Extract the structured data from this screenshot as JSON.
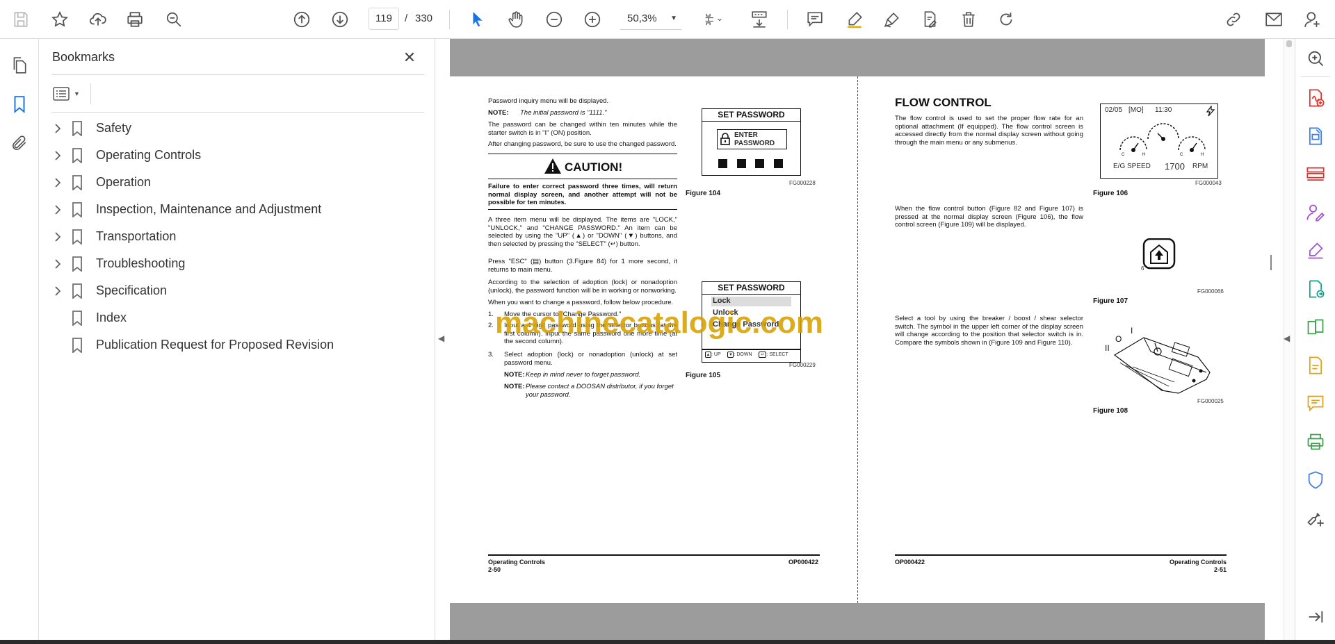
{
  "toolbar": {
    "page_current": "119",
    "page_separator": "/",
    "page_total": "330",
    "zoom": "50,3%"
  },
  "bookmarks": {
    "title": "Bookmarks",
    "items": [
      {
        "label": "Safety",
        "expandable": true
      },
      {
        "label": "Operating Controls",
        "expandable": true
      },
      {
        "label": "Operation",
        "expandable": true
      },
      {
        "label": "Inspection, Maintenance and Adjustment",
        "expandable": true
      },
      {
        "label": "Transportation",
        "expandable": true
      },
      {
        "label": "Troubleshooting",
        "expandable": true
      },
      {
        "label": "Specification",
        "expandable": true
      },
      {
        "label": "Index",
        "expandable": false
      },
      {
        "label": "Publication Request for Proposed Revision",
        "expandable": false
      }
    ]
  },
  "document": {
    "left_page": {
      "intro": "Password inquiry menu will be displayed.",
      "note_label": "NOTE:",
      "note_text": "The initial password is \"1111.\"",
      "para_change": "The password can be changed within ten minutes while the starter switch is in \"I\" (ON) position.",
      "para_after": "After changing password, be sure to use the changed password.",
      "caution_title": "CAUTION!",
      "caution_text": "Failure to enter correct password three times, will return normal display screen, and another attempt will not be possible for ten minutes.",
      "para_three_items": "A three item menu will be displayed. The items are \"LOCK,\" \"UNLOCK,\" and \"CHANGE PASSWORD.\" An item can be selected by using the \"UP\" (▲) or \"DOWN\" (▼) buttons, and then selected by pressing the \"SELECT\" (↵) button.",
      "para_esc": "Press \"ESC\" (▤) button (3.Figure 84) for 1 more second, it returns to main menu.",
      "para_selection": "According to the selection of adoption (lock) or nonadoption (unlock), the password function will be in working or nonworking.",
      "para_procedure": "When you want to change a password, follow below procedure.",
      "steps": [
        {
          "num": "1.",
          "text": "Move the cursor to \"Change Password.\""
        },
        {
          "num": "2.",
          "text": "Input a 4 digit password using the selector buttons (at the first column). Input the same password one more time (at the second column)."
        },
        {
          "num": "3.",
          "text": "Select adoption (lock) or nonadoption (unlock) at set password menu."
        }
      ],
      "note2_label": "NOTE:",
      "note2_text": "Keep in mind never to forget password.",
      "note3_label": "NOTE:",
      "note3_text": "Please contact a DOOSAN distributor, if you forget your password.",
      "fig104": {
        "title": "SET PASSWORD",
        "enter": "ENTER",
        "password": "PASSWORD",
        "code": "FG000228",
        "caption": "Figure 104"
      },
      "fig105": {
        "title": "SET PASSWORD",
        "lock": "Lock",
        "unlock": "Unlock",
        "change": "Change Password",
        "up": ": UP",
        "down": ": DOWN",
        "select": ": SELECT",
        "code": "FG000229",
        "caption": "Figure 105"
      },
      "footer_title": "Operating Controls",
      "footer_page": "2-50",
      "footer_code": "OP000422"
    },
    "right_page": {
      "title": "FLOW CONTROL",
      "para1": "The flow control is used to set the proper flow rate for an optional attachment (If equipped). The flow control screen is accessed directly from the normal display screen without going through the main menu or any submenus.",
      "para2": "When the flow control button (Figure 82 and Figure 107) is pressed at the normal display screen (Figure 106), the flow control screen (Figure 109) will be displayed.",
      "para3": "Select a tool by using the breaker / boost / shear selector switch. The symbol in the upper left corner of the display screen will change according to the position that selector switch is in. Compare the symbols shown in (Figure 109 and Figure 110).",
      "fig106": {
        "date": "02/05",
        "day": "[MO]",
        "time": "11:30",
        "speed_label": "E/G SPEED",
        "speed_value": "1700",
        "speed_unit": "RPM",
        "code": "FG000043",
        "caption": "Figure 106"
      },
      "fig107": {
        "num": "6",
        "code": "FG000066",
        "caption": "Figure 107"
      },
      "fig108": {
        "label_i": "I",
        "label_o": "O",
        "label_ii": "II",
        "code": "FG000025",
        "caption": "Figure 108"
      },
      "footer_code": "OP000422",
      "footer_title": "Operating Controls",
      "footer_page": "2-51"
    },
    "watermark": "machinecatalogic.com"
  }
}
